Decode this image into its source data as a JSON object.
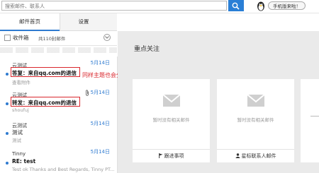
{
  "search": {
    "placeholder": "搜索邮件、联系人"
  },
  "top": {
    "mobile_label": "手机版来啦！"
  },
  "tabs": [
    {
      "label": "邮件首页"
    },
    {
      "label": "设置"
    }
  ],
  "list_header": {
    "folder": "收件箱",
    "count": "共110封邮件"
  },
  "mails": [
    {
      "sender": "云测试",
      "date": "5月14日",
      "subject": "答复：来自qq.com的退信",
      "preview": "查看附件"
    },
    {
      "sender": "云测试",
      "date": "5月14日",
      "subject": "转发：来自qq.com的退信",
      "preview": "shoufuj"
    },
    {
      "sender": "云测试",
      "date": "5月14日",
      "subject": "测试",
      "preview": "测试"
    },
    {
      "sender": "Tinny",
      "date": "5月14日",
      "subject": "RE: test",
      "preview": "Test ok Thanks and Best Regards, Tinny PT..."
    }
  ],
  "annotation": "同样主题也会分别显示",
  "panel": {
    "title": "重点关注",
    "cards": [
      {
        "empty_text": "暂时没有相关邮件",
        "action": "跟进事项",
        "action_icon": "flag-icon"
      },
      {
        "empty_text": "暂时没有相关邮件",
        "action": "星标联系人邮件",
        "action_icon": "person-icon"
      }
    ]
  },
  "colors": {
    "accent": "#2f7bd0",
    "search_button": "#2a7fd6",
    "annotation_red": "#d9262c"
  }
}
